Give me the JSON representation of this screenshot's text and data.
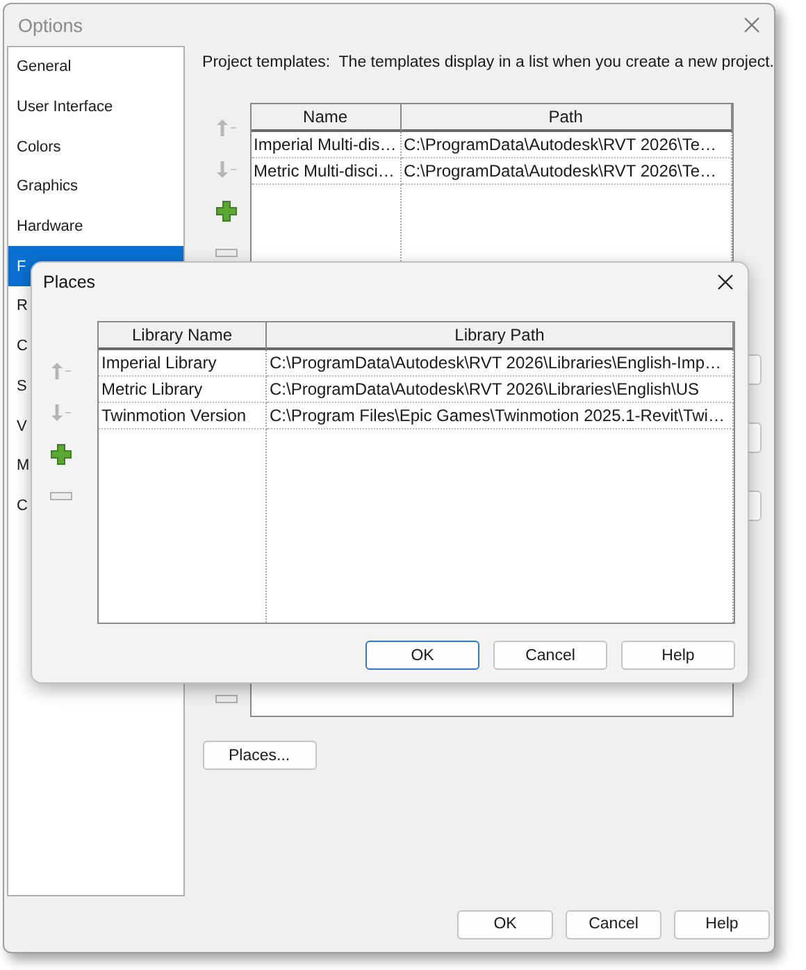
{
  "options": {
    "title": "Options",
    "sidebar": {
      "items": [
        {
          "label": "General",
          "selected": false
        },
        {
          "label": "User Interface",
          "selected": false
        },
        {
          "label": "Colors",
          "selected": false
        },
        {
          "label": "Graphics",
          "selected": false
        },
        {
          "label": "Hardware",
          "selected": false
        },
        {
          "label": "F",
          "selected": true
        },
        {
          "label": "R",
          "selected": false
        },
        {
          "label": "C",
          "selected": false
        },
        {
          "label": "S",
          "selected": false
        },
        {
          "label": "V",
          "selected": false
        },
        {
          "label": "M",
          "selected": false
        },
        {
          "label": "C",
          "selected": false
        }
      ]
    },
    "description": "Project templates:  The templates display in a list when you create a new project.",
    "templates": {
      "columns": [
        "Name",
        "Path"
      ],
      "rows": [
        [
          "Imperial Multi-dis…",
          "C:\\ProgramData\\Autodesk\\RVT 2026\\Te…"
        ],
        [
          "Metric Multi-disci…",
          "C:\\ProgramData\\Autodesk\\RVT 2026\\Te…"
        ]
      ]
    },
    "places_button": "Places...",
    "buttons": [
      "OK",
      "Cancel",
      "Help"
    ]
  },
  "places_dialog": {
    "title": "Places",
    "columns": [
      "Library Name",
      "Library Path"
    ],
    "rows": [
      [
        "Imperial Library",
        "C:\\ProgramData\\Autodesk\\RVT 2026\\Libraries\\English-Imp…"
      ],
      [
        "Metric Library",
        "C:\\ProgramData\\Autodesk\\RVT 2026\\Libraries\\English\\US"
      ],
      [
        "Twinmotion Version",
        "C:\\Program Files\\Epic Games\\Twinmotion 2025.1-Revit\\Twi…"
      ]
    ],
    "buttons": [
      {
        "label": "OK",
        "default": true
      },
      {
        "label": "Cancel",
        "default": false
      },
      {
        "label": "Help",
        "default": false
      }
    ]
  }
}
